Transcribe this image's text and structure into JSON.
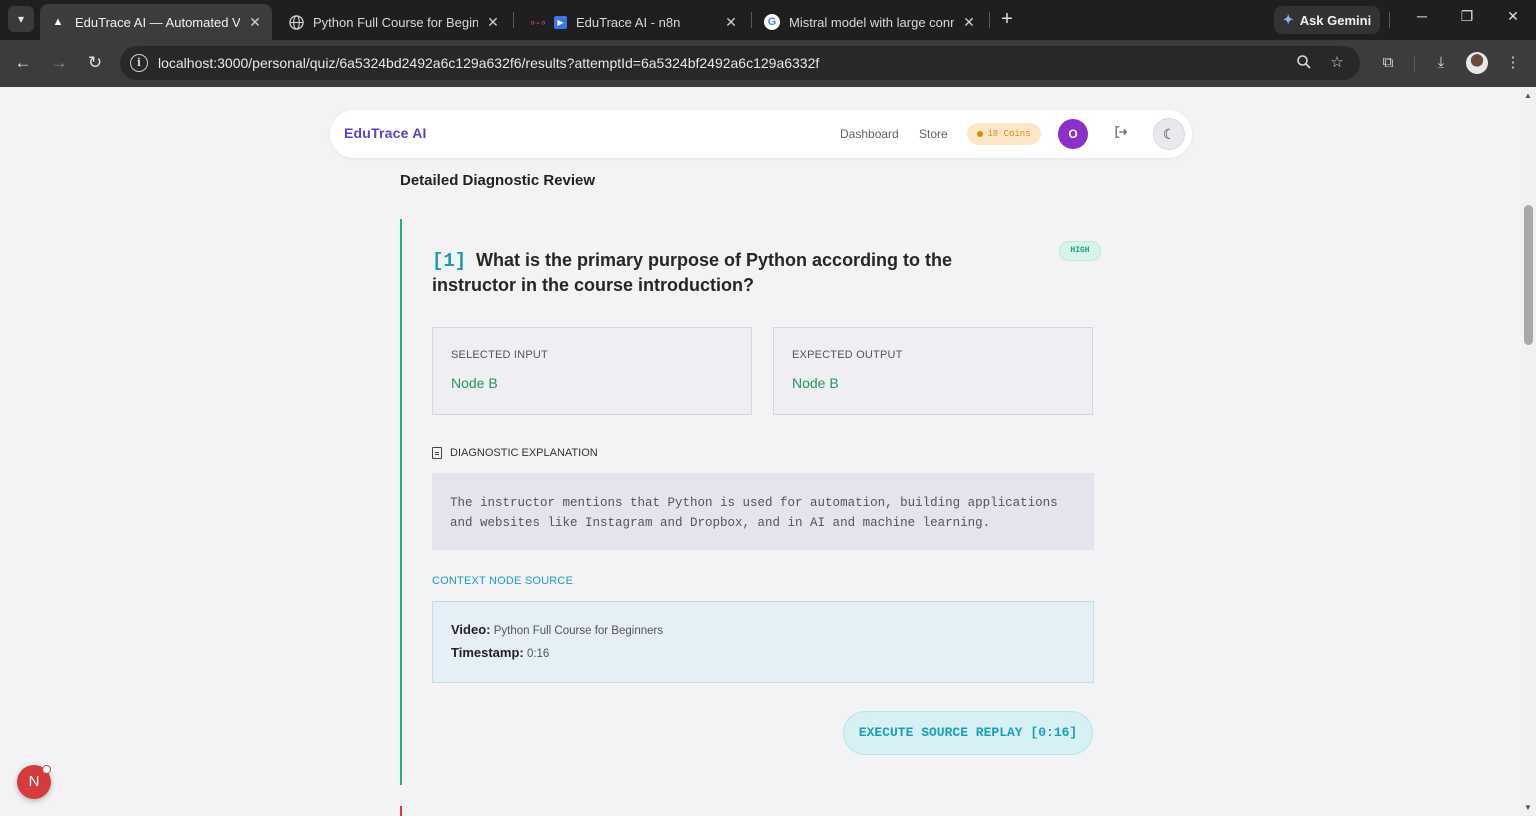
{
  "browser": {
    "tabs": [
      {
        "title": "EduTrace AI — Automated Vide",
        "favicon": "triangle-icon",
        "active": true
      },
      {
        "title": "Python Full Course for Beginner",
        "favicon": "globe-icon",
        "active": false
      },
      {
        "title": "EduTrace AI - n8n",
        "favicon": "n8n-icon",
        "active": false
      },
      {
        "title": "Mistral model with large conrte",
        "favicon": "google-icon",
        "active": false
      }
    ],
    "new_tab_symbol": "+",
    "ask_gemini_label": "Ask Gemini",
    "url": "localhost:3000/personal/quiz/6a5324bd2492a6c129a632f6/results?attemptId=6a5324bf2492a6c129a6332f"
  },
  "app": {
    "brand": "EduTrace AI",
    "nav": {
      "dashboard": "Dashboard",
      "store": "Store"
    },
    "coins_label": "18 Coins",
    "avatar_initial": "O"
  },
  "review": {
    "section_title": "Detailed Diagnostic Review",
    "question": {
      "number": "[1]",
      "text": "What is the primary purpose of Python according to the instructor in the course introduction?",
      "difficulty": "HIGH"
    },
    "selected": {
      "label": "SELECTED INPUT",
      "value": "Node B"
    },
    "expected": {
      "label": "EXPECTED OUTPUT",
      "value": "Node B"
    },
    "explanation": {
      "label": "DIAGNOSTIC EXPLANATION",
      "text": "The instructor mentions that Python is used for automation, building applications and websites like Instagram and Dropbox, and in AI and machine learning."
    },
    "context": {
      "label": "CONTEXT NODE SOURCE",
      "video_label": "Video:",
      "video_value": "Python Full Course for Beginners",
      "timestamp_label": "Timestamp:",
      "timestamp_value": "0:16"
    },
    "replay_button": "EXECUTE SOURCE REPLAY [0:16]"
  },
  "floating_badge": {
    "letter": "N"
  },
  "colors": {
    "brand": "#5b3fc4",
    "correct": "#1f9a5e",
    "accent_teal": "#1aa0b6",
    "timeline": "#20b07a"
  }
}
